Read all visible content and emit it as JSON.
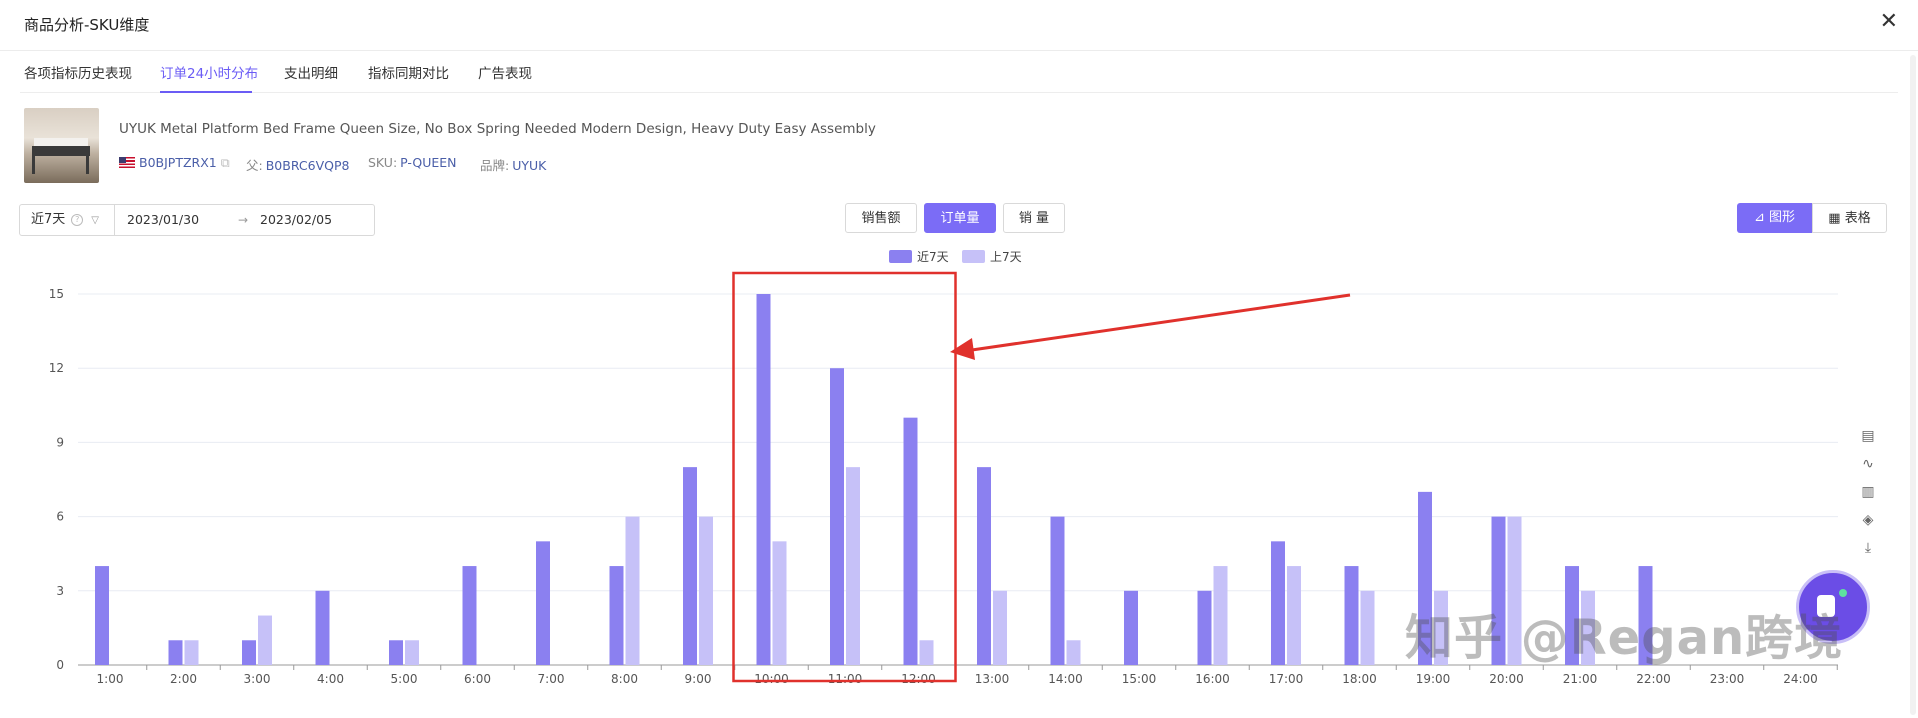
{
  "window": {
    "title": "商品分析-SKU维度",
    "close_glyph": "✕"
  },
  "tabs": [
    {
      "label": "各项指标历史表现",
      "active": false
    },
    {
      "label": "订单24小时分布",
      "active": true
    },
    {
      "label": "支出明细",
      "active": false
    },
    {
      "label": "指标同期对比",
      "active": false
    },
    {
      "label": "广告表现",
      "active": false
    }
  ],
  "product": {
    "name": "UYUK Metal Platform Bed Frame Queen Size, No Box Spring Needed Modern Design, Heavy Duty Easy Assembly",
    "asin": "B0BJPTZRX1",
    "parent_label": "父:",
    "parent": "B0BRC6VQP8",
    "sku_label": "SKU:",
    "sku": "P-QUEEN",
    "brand_label": "品牌:",
    "brand": "UYUK"
  },
  "date_range": {
    "period": "近7天",
    "start": "2023/01/30",
    "arrow": "→",
    "end": "2023/02/05"
  },
  "metric_buttons": [
    {
      "label": "销售额",
      "active": false
    },
    {
      "label": "订单量",
      "active": true
    },
    {
      "label": "销 量",
      "active": false
    }
  ],
  "view_buttons": [
    {
      "label": "图形",
      "icon": "chart-icon",
      "active": true
    },
    {
      "label": "表格",
      "icon": "grid-icon",
      "active": false
    }
  ],
  "colors": {
    "accent": "#7b6cf6",
    "series_current": "#8b80f0",
    "series_previous": "#c6c1f8",
    "highlight": "#e0312c"
  },
  "chart_data": {
    "type": "bar",
    "categories": [
      "1:00",
      "2:00",
      "3:00",
      "4:00",
      "5:00",
      "6:00",
      "7:00",
      "8:00",
      "9:00",
      "10:00",
      "11:00",
      "12:00",
      "13:00",
      "14:00",
      "15:00",
      "16:00",
      "17:00",
      "18:00",
      "19:00",
      "20:00",
      "21:00",
      "22:00",
      "23:00",
      "24:00"
    ],
    "series": [
      {
        "name": "近7天",
        "values": [
          4,
          1,
          1,
          3,
          1,
          4,
          5,
          4,
          8,
          15,
          12,
          10,
          8,
          6,
          3,
          3,
          5,
          4,
          7,
          6,
          4,
          4,
          0,
          0
        ]
      },
      {
        "name": "上7天",
        "values": [
          0,
          1,
          2,
          0,
          1,
          0,
          0,
          6,
          6,
          5,
          8,
          1,
          3,
          1,
          0,
          4,
          4,
          3,
          3,
          6,
          3,
          0,
          0,
          0
        ]
      }
    ],
    "yticks": [
      0,
      3,
      6,
      9,
      12,
      15
    ],
    "ylim": [
      0,
      15
    ],
    "grid": true,
    "legend_position": "top-center",
    "highlighted_categories": [
      "10:00",
      "11:00",
      "12:00"
    ]
  },
  "side_tools": [
    "document-icon",
    "line-chart-icon",
    "bar-chart-icon",
    "layers-icon",
    "download-icon"
  ],
  "watermark": "知乎 @Regan跨境"
}
